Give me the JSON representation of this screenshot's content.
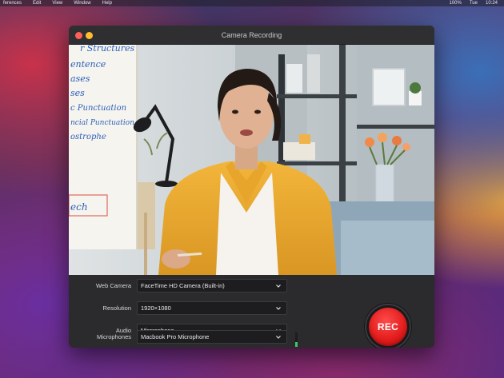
{
  "menubar": {
    "items": [
      "ferences",
      "Edit",
      "View",
      "Window",
      "Help"
    ],
    "status": [
      "100%",
      "Tue",
      "10:24"
    ]
  },
  "window": {
    "title": "Camera Recording"
  },
  "whiteboard": {
    "lines": [
      "r Structures",
      "entence",
      "ases",
      "ses",
      "c Punctuation",
      "ncial Punctuation",
      "ostrophe",
      "ech"
    ]
  },
  "controls": {
    "rows": [
      {
        "label": "Web Camera",
        "value": "FaceTime HD Camera (Built-in)"
      },
      {
        "label": "Resolution",
        "value": "1920×1080"
      },
      {
        "label": "Audio",
        "value": "Mircrophone"
      },
      {
        "label": "Microphones",
        "value": "Macbook Pro Microphone"
      }
    ],
    "audio_level": 0.35,
    "rec_label": "REC"
  },
  "colors": {
    "rec": "#e11a1a",
    "window_bg": "#2b2b2d",
    "level": "#3fc46a"
  }
}
